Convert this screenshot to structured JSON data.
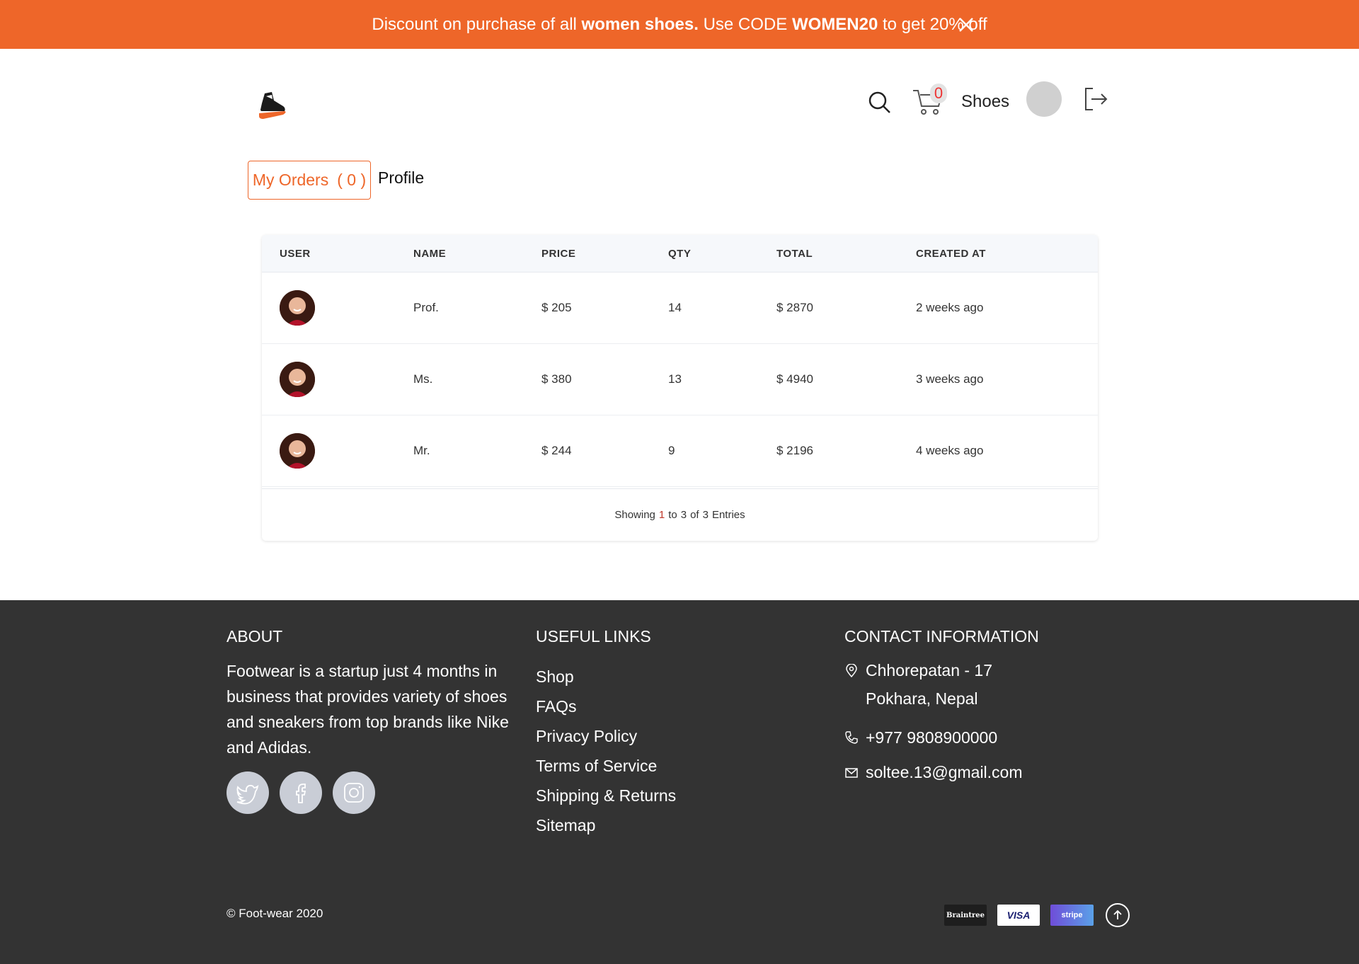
{
  "promo": {
    "text_1": "Discount on purchase of all",
    "text_bold_1": "women shoes.",
    "text_2": "Use CODE",
    "text_bold_2": "WOMEN20",
    "text_3": "to get 20% off",
    "bg_color": "#ee6629"
  },
  "header": {
    "cart_count": "0",
    "shoes_label": "Shoes"
  },
  "tabs": {
    "orders_label": "My Orders",
    "orders_count": "( 0 )",
    "profile_label": "Profile"
  },
  "table": {
    "columns": [
      "USER",
      "NAME",
      "PRICE",
      "QTY",
      "TOTAL",
      "CREATED AT"
    ],
    "rows": [
      {
        "name": "Prof.",
        "price": "$ 205",
        "qty": "14",
        "total": "$ 2870",
        "created": "2 weeks ago"
      },
      {
        "name": "Ms.",
        "price": "$ 380",
        "qty": "13",
        "total": "$ 4940",
        "created": "3 weeks ago"
      },
      {
        "name": "Mr.",
        "price": "$ 244",
        "qty": "9",
        "total": "$ 2196",
        "created": "4 weeks ago"
      }
    ],
    "footer": {
      "showing": "Showing",
      "from": "1",
      "to_word": "to",
      "to": "3",
      "of_word": "of",
      "total": "3",
      "entries": "Entries"
    }
  },
  "footer": {
    "about_title": "ABOUT",
    "about_text": "Footwear is a startup just 4 months in business that provides variety of shoes and sneakers from top brands like Nike and Adidas.",
    "links_title": "USEFUL LINKS",
    "links": [
      "Shop",
      "FAQs",
      "Privacy Policy",
      "Terms of Service",
      "Shipping & Returns",
      "Sitemap"
    ],
    "contact_title": "CONTACT INFORMATION",
    "address_line1": "Chhorepatan - 17",
    "address_line2": "Pokhara, Nepal",
    "phone": "+977 9808900000",
    "email": "soltee.13@gmail.com",
    "copyright": "© Foot-wear 2020",
    "payments": {
      "braintree": "Braintree",
      "visa": "VISA",
      "stripe": "stripe"
    },
    "bg_color": "#333333"
  }
}
